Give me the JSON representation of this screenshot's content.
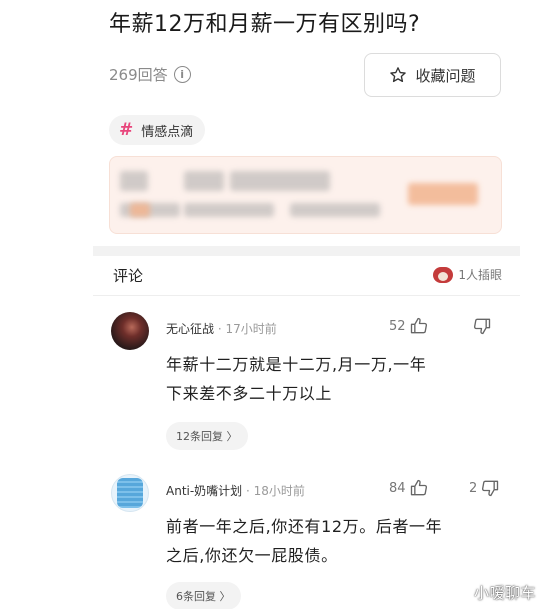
{
  "question": {
    "title": "年薪12万和月薪一万有区别吗?",
    "answer_count": "269回答",
    "favorite_label": "收藏问题",
    "tag": "情感点滴"
  },
  "comments_section": {
    "label": "评论",
    "watching": "1人插眼"
  },
  "comments": [
    {
      "user": "无心征战",
      "time": "· 17小时前",
      "likes": "52",
      "dislikes": "",
      "line1": "年薪十二万就是十二万,月一万,一年",
      "line2": "下来差不多二十万以上",
      "replies": "12条回复 〉"
    },
    {
      "user": "Anti-奶嘴计划",
      "time": "· 18小时前",
      "likes": "84",
      "dislikes": "2",
      "line1": "前者一年之后,你还有12万。后者一年",
      "line2": "之后,你还欠一屁股债。",
      "replies": "6条回复 〉"
    }
  ],
  "watermark": "小嗳聊车",
  "colors": {
    "accent_tag": "#e8467c",
    "ad_bg": "#fdf1ec"
  }
}
